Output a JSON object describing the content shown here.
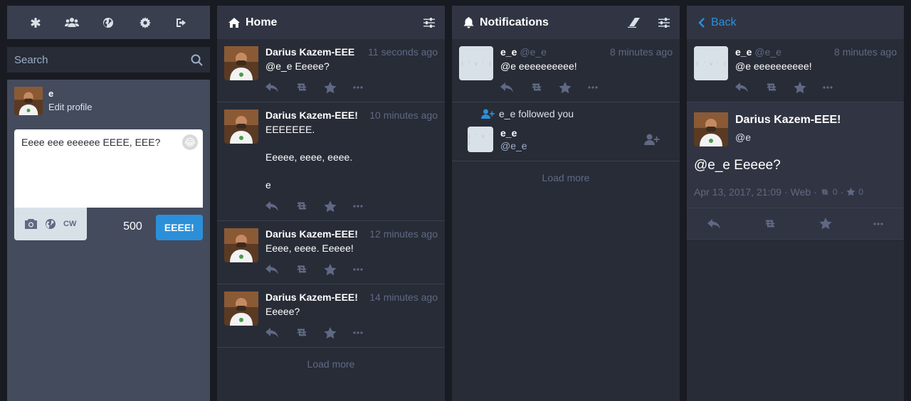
{
  "drawer": {
    "tabs": [
      "asterisk-icon",
      "users-icon",
      "globe-icon",
      "gear-icon",
      "sign-out-icon"
    ],
    "search_placeholder": "Search",
    "me": {
      "name": "e",
      "edit_label": "Edit profile"
    },
    "compose": {
      "text": "Eeee eee eeeeee EEEE, EEE?",
      "cw_label": "CW",
      "counter": "500",
      "submit_label": "EEEE!"
    }
  },
  "home": {
    "title": "Home",
    "statuses": [
      {
        "name": "Darius Kazem-EEE",
        "time": "11 seconds ago",
        "content": [
          "@e_e Eeeee?"
        ]
      },
      {
        "name": "Darius Kazem-EEE!",
        "time": "10 minutes ago",
        "content": [
          "EEEEEEE.",
          "Eeeee, eeee, eeee.",
          "e"
        ]
      },
      {
        "name": "Darius Kazem-EEE!",
        "time": "12 minutes ago",
        "content": [
          "Eeee, eeee. Eeeee!"
        ]
      },
      {
        "name": "Darius Kazem-EEE!",
        "time": "14 minutes ago",
        "content": [
          "Eeeee?"
        ]
      }
    ],
    "load_more": "Load more"
  },
  "notifications": {
    "title": "Notifications",
    "mention": {
      "name": "e_e",
      "acct": "@e_e",
      "time": "8 minutes ago",
      "content": "@e eeeeeeeeee!"
    },
    "follow": {
      "text": "e_e followed you",
      "name": "e_e",
      "acct": "@e_e"
    },
    "load_more": "Load more"
  },
  "detail_column": {
    "back_label": "Back",
    "parent": {
      "name": "e_e",
      "acct": "@e_e",
      "time": "8 minutes ago",
      "content": "@e eeeeeeeeee!"
    },
    "status": {
      "name": "Darius Kazem-EEE!",
      "acct": "@e",
      "content": "@e_e Eeeee?",
      "date": "Apr 13, 2017, 21:09",
      "app": "Web",
      "reblogs": "0",
      "favourites": "0"
    }
  },
  "colors": {
    "background": "#191b22",
    "column": "#282c37",
    "header": "#313543",
    "accent": "#2b90d9",
    "muted": "#606984"
  }
}
